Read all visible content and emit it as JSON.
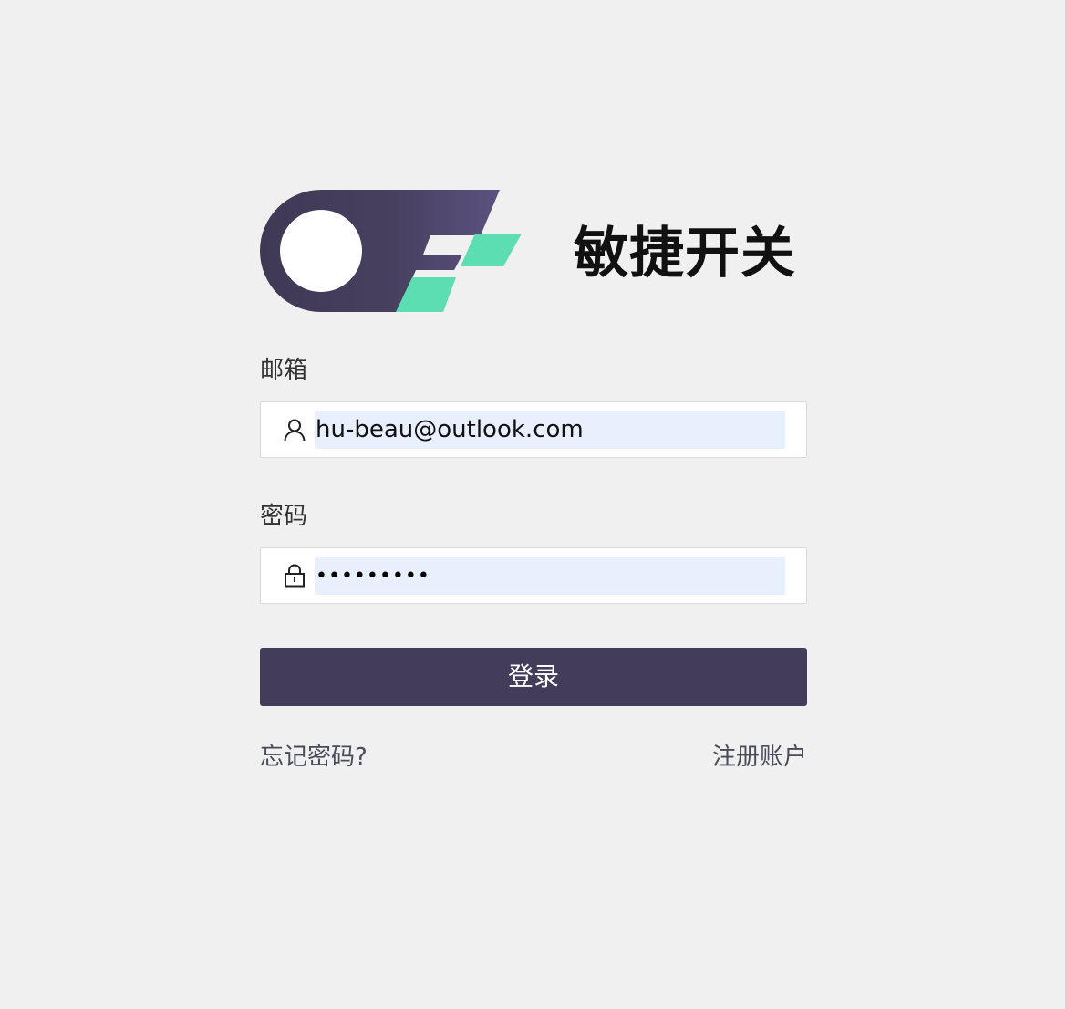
{
  "brand": {
    "name": "敏捷开关",
    "colors": {
      "dark": "#433c5b",
      "dark_light": "#5b5280",
      "accent": "#5dddb2"
    }
  },
  "form": {
    "email_label": "邮箱",
    "email_value": "hu-beau@outlook.com",
    "email_icon": "user-icon",
    "password_label": "密码",
    "password_value": "•••••••••",
    "password_icon": "lock-icon",
    "submit_label": "登录"
  },
  "links": {
    "forgot_password": "忘记密码?",
    "register": "注册账户"
  },
  "colors": {
    "background": "#f0f0f0",
    "button": "#433c5b",
    "autofill": "#e8f0fe"
  }
}
